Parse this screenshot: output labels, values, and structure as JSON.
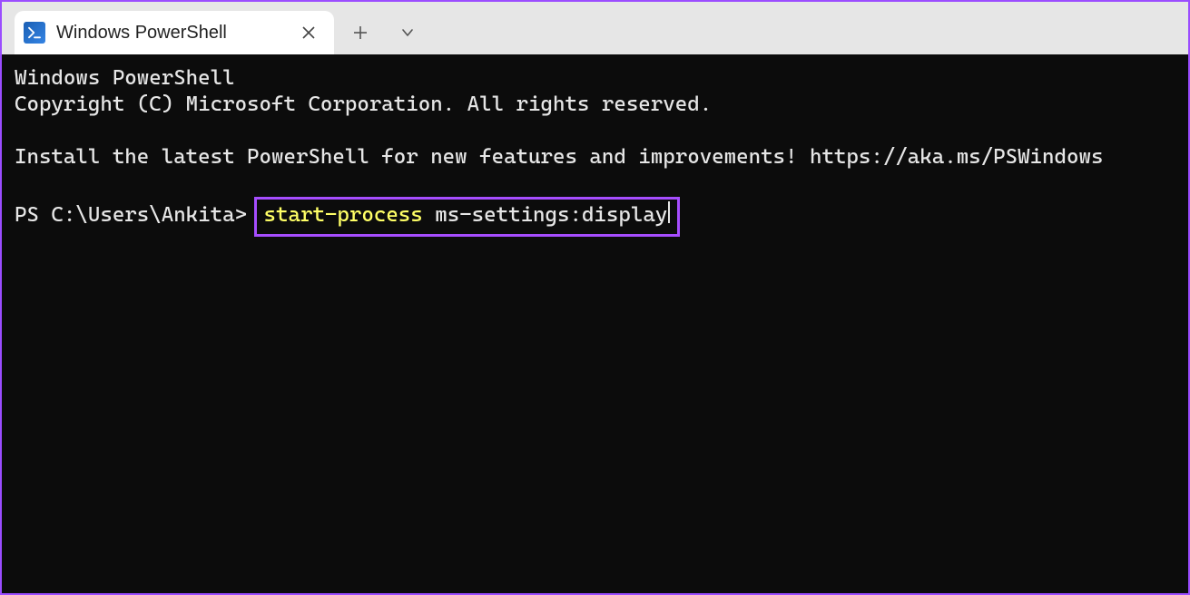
{
  "tab": {
    "title": "Windows PowerShell",
    "icon_name": "powershell-icon"
  },
  "terminal": {
    "header_line1": "Windows PowerShell",
    "header_line2": "Copyright (C) Microsoft Corporation. All rights reserved.",
    "install_line": "Install the latest PowerShell for new features and improvements! https://aka.ms/PSWindows",
    "prompt": "PS C:\\Users\\Ankita>",
    "command_keyword": "start-process",
    "command_arg": "ms-settings:display"
  }
}
